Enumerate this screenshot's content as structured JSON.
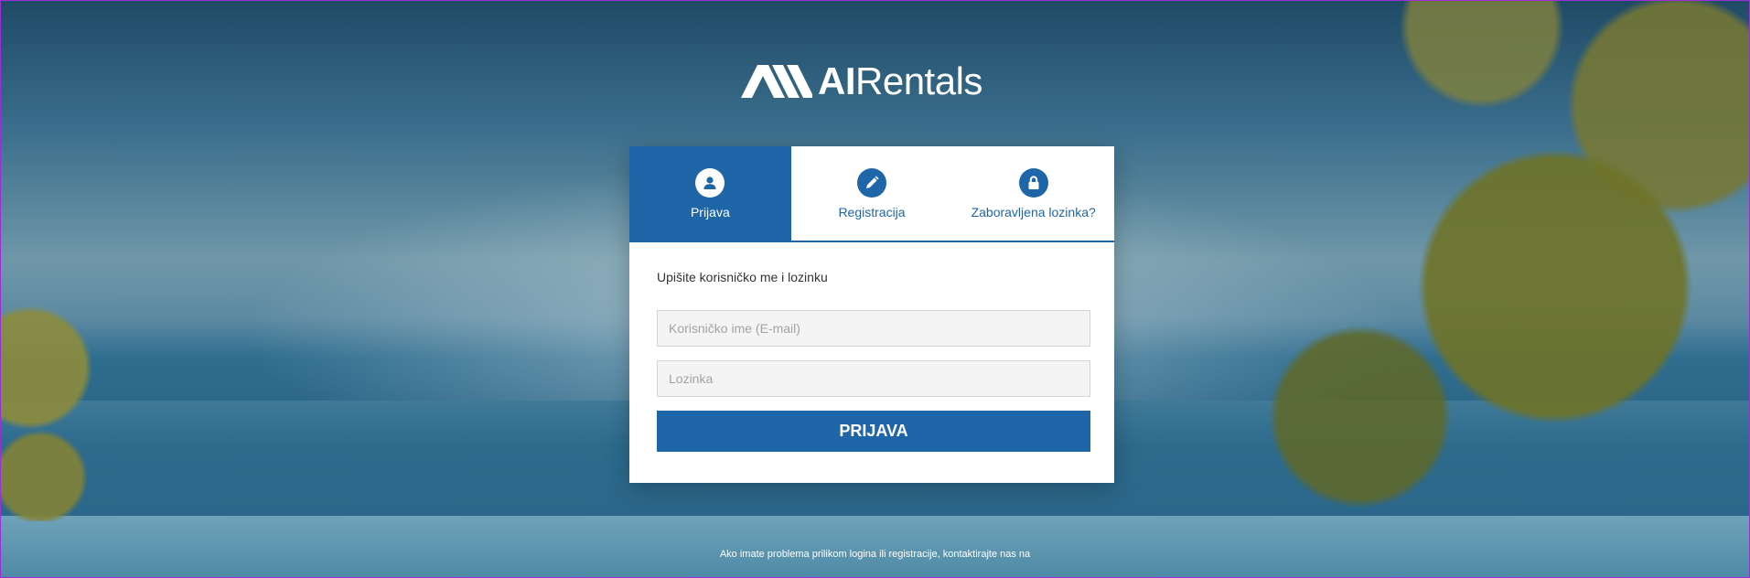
{
  "brand": {
    "name_bold": "AI",
    "name_light": "Rentals"
  },
  "tabs": [
    {
      "label": "Prijava",
      "icon": "user-icon",
      "active": true
    },
    {
      "label": "Registracija",
      "icon": "pencil-icon",
      "active": false
    },
    {
      "label": "Zaboravljena lozinka?",
      "icon": "lock-icon",
      "active": false
    }
  ],
  "login_form": {
    "instruction": "Upišite korisničko me i lozinku",
    "username_placeholder": "Korisničko ime (E-mail)",
    "password_placeholder": "Lozinka",
    "submit_label": "PRIJAVA"
  },
  "footer": {
    "help_text": "Ako imate problema prilikom logina ili registracije, kontaktirajte nas na"
  },
  "colors": {
    "accent": "#1f66a8",
    "frame": "#9b2fd6"
  }
}
